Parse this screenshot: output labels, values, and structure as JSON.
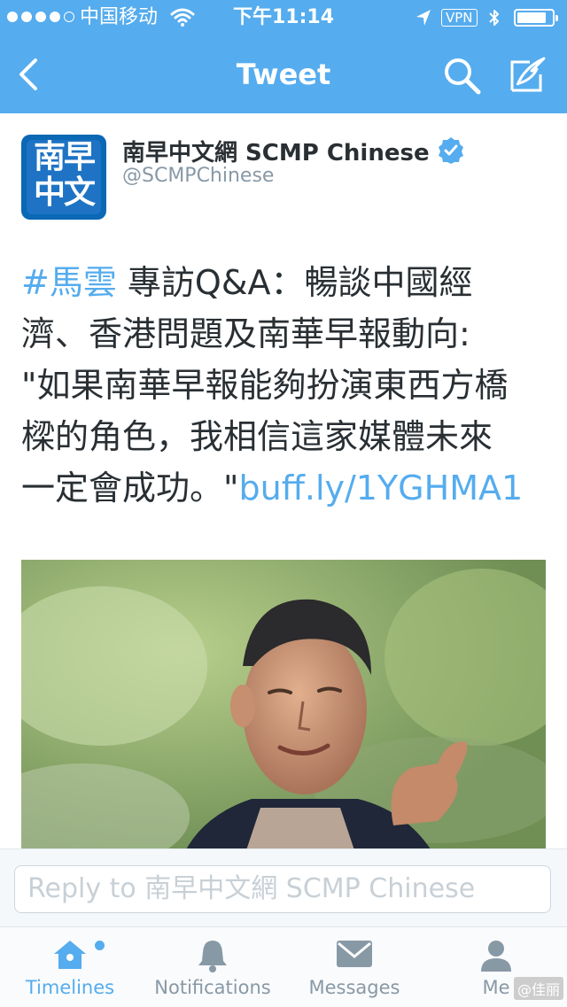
{
  "status_bar": {
    "carrier": "中国移动",
    "time": "下午11:14",
    "vpn": "VPN"
  },
  "navbar": {
    "title": "Tweet"
  },
  "tweet": {
    "avatar_line1": "南早",
    "avatar_line2": "中文",
    "display_name": "南早中文網 SCMP Chinese",
    "handle": "@SCMPChinese",
    "lines": [
      {
        "hashtag": "#馬雲",
        "text": " 專訪Q&A：暢談中國經"
      },
      {
        "text": "濟、香港問題及南華早報動向:"
      },
      {
        "text": "\"如果南華早報能夠扮演東西方橋"
      },
      {
        "text": "樑的角色，我相信這家媒體未來"
      },
      {
        "text": "一定會成功。\"",
        "link": "buff.ly/1YGHMA1"
      }
    ]
  },
  "reply": {
    "placeholder": "Reply to 南早中文網 SCMP Chinese"
  },
  "tabs": [
    {
      "label": "Timelines",
      "icon": "home-icon",
      "active": true
    },
    {
      "label": "Notifications",
      "icon": "bell-icon"
    },
    {
      "label": "Messages",
      "icon": "envelope-icon"
    },
    {
      "label": "Me",
      "icon": "person-icon"
    }
  ],
  "watermark": "@佳丽",
  "colors": {
    "brand": "#55acee",
    "avatar_bg": "#0a68b5",
    "text": "#292f33",
    "muted": "#8899a6"
  }
}
